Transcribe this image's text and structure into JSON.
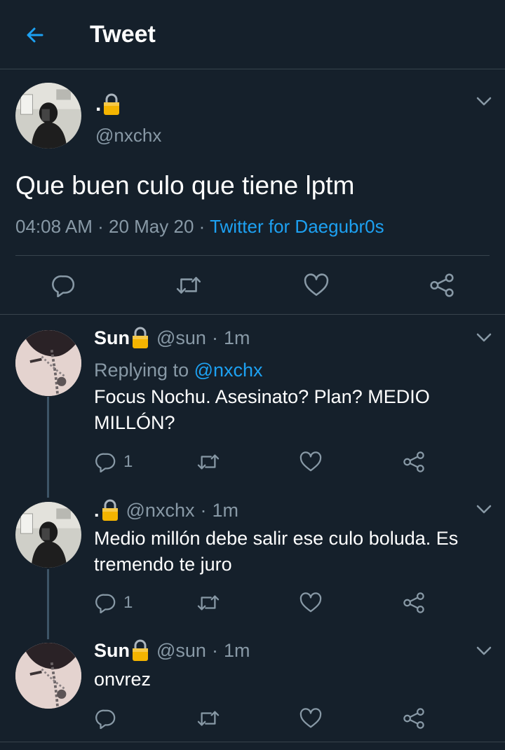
{
  "header": {
    "title": "Tweet"
  },
  "main_tweet": {
    "name": ".",
    "handle": "@nxchx",
    "text": "Que buen culo que tiene lptm",
    "time": "04:08 AM",
    "date": "20 May 20",
    "source": "Twitter for Daegubr0s"
  },
  "replies": [
    {
      "name": "Sun",
      "handle": "@sun",
      "time": "1m",
      "replying_prefix": "Replying to",
      "replying_to": "@nxchx",
      "text": "Focus Nochu. Asesinato? Plan? MEDIO MILLÓN?",
      "reply_count": "1"
    },
    {
      "name": ".",
      "handle": "@nxchx",
      "time": "1m",
      "text": "Medio millón debe salir ese culo boluda. Es tremendo te juro",
      "reply_count": "1"
    },
    {
      "name": "Sun",
      "handle": "@sun",
      "time": "1m",
      "text": "onvrez",
      "reply_count": ""
    }
  ],
  "separator": "·",
  "colors": {
    "background": "#15202b",
    "accent": "#1da1f2",
    "muted": "#8899a6",
    "lock": "#f4b400"
  }
}
